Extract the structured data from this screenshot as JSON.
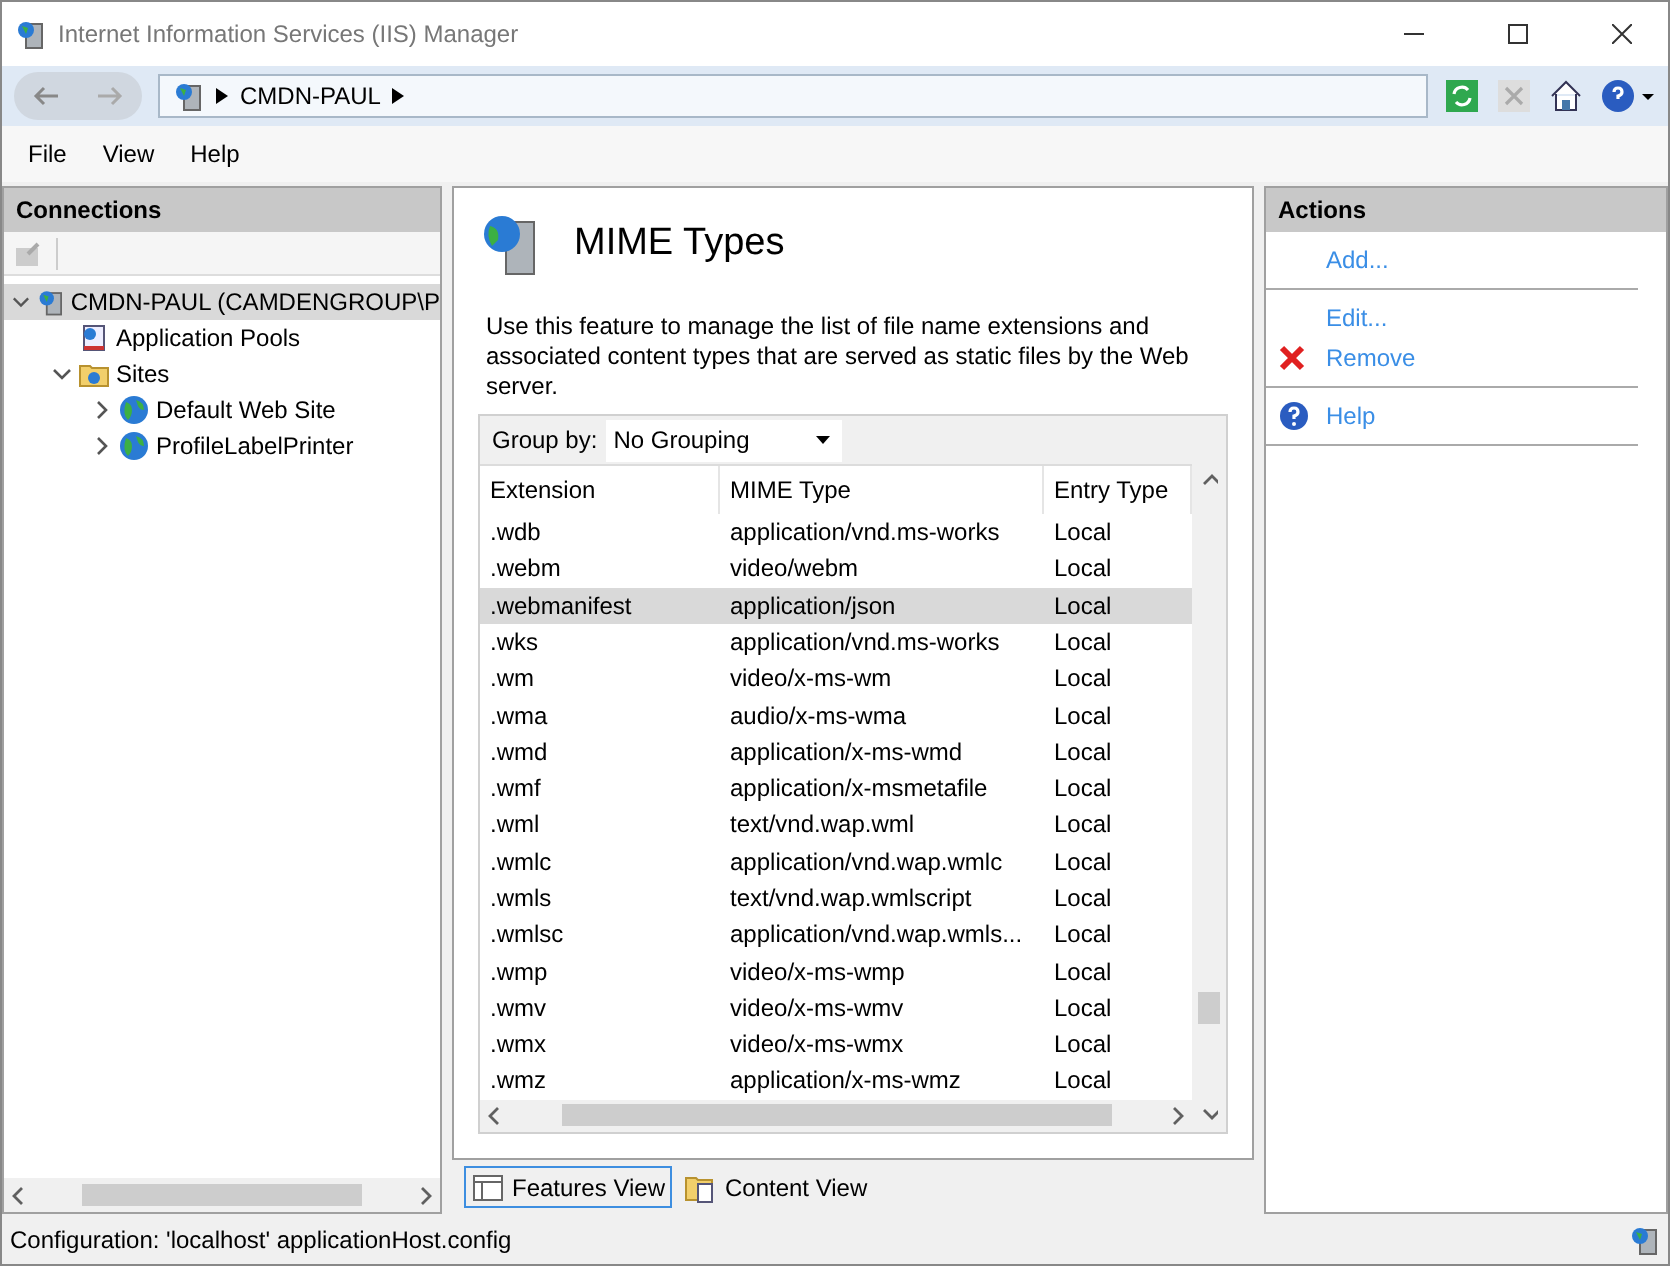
{
  "window": {
    "title": "Internet Information Services (IIS) Manager"
  },
  "address": {
    "crumbs": [
      "CMDN-PAUL"
    ]
  },
  "menu": [
    "File",
    "View",
    "Help"
  ],
  "connections": {
    "title": "Connections",
    "tree": [
      {
        "label": "CMDN-PAUL (CAMDENGROUP\\P",
        "kind": "server",
        "expanded": true,
        "selected": true,
        "children": [
          {
            "label": "Application Pools",
            "kind": "pools",
            "selected": false
          },
          {
            "label": "Sites",
            "kind": "sites",
            "expanded": true,
            "selected": false,
            "children": [
              {
                "label": "Default Web Site",
                "kind": "site",
                "expanded": false,
                "selected": false
              },
              {
                "label": "ProfileLabelPrinter",
                "kind": "site",
                "expanded": false,
                "selected": false
              }
            ]
          }
        ]
      }
    ]
  },
  "feature": {
    "title": "MIME Types",
    "description": "Use this feature to manage the list of file name extensions and associated content types that are served as static files by the Web server.",
    "group_by": {
      "label": "Group by:",
      "value": "No Grouping"
    },
    "columns": [
      "Extension",
      "MIME Type",
      "Entry Type"
    ],
    "rows": [
      {
        "cells": [
          ".wdb",
          "application/vnd.ms-works",
          "Local"
        ],
        "selected": false
      },
      {
        "cells": [
          ".webm",
          "video/webm",
          "Local"
        ],
        "selected": false
      },
      {
        "cells": [
          ".webmanifest",
          "application/json",
          "Local"
        ],
        "selected": true
      },
      {
        "cells": [
          ".wks",
          "application/vnd.ms-works",
          "Local"
        ],
        "selected": false
      },
      {
        "cells": [
          ".wm",
          "video/x-ms-wm",
          "Local"
        ],
        "selected": false
      },
      {
        "cells": [
          ".wma",
          "audio/x-ms-wma",
          "Local"
        ],
        "selected": false
      },
      {
        "cells": [
          ".wmd",
          "application/x-ms-wmd",
          "Local"
        ],
        "selected": false
      },
      {
        "cells": [
          ".wmf",
          "application/x-msmetafile",
          "Local"
        ],
        "selected": false
      },
      {
        "cells": [
          ".wml",
          "text/vnd.wap.wml",
          "Local"
        ],
        "selected": false
      },
      {
        "cells": [
          ".wmlc",
          "application/vnd.wap.wmlc",
          "Local"
        ],
        "selected": false
      },
      {
        "cells": [
          ".wmls",
          "text/vnd.wap.wmlscript",
          "Local"
        ],
        "selected": false
      },
      {
        "cells": [
          ".wmlsc",
          "application/vnd.wap.wmls...",
          "Local"
        ],
        "selected": false
      },
      {
        "cells": [
          ".wmp",
          "video/x-ms-wmp",
          "Local"
        ],
        "selected": false
      },
      {
        "cells": [
          ".wmv",
          "video/x-ms-wmv",
          "Local"
        ],
        "selected": false
      },
      {
        "cells": [
          ".wmx",
          "video/x-ms-wmx",
          "Local"
        ],
        "selected": false
      },
      {
        "cells": [
          ".wmz",
          "application/x-ms-wmz",
          "Local"
        ],
        "selected": false
      }
    ],
    "views": [
      {
        "label": "Features View",
        "kind": "features",
        "selected": true
      },
      {
        "label": "Content View",
        "kind": "content",
        "selected": false
      }
    ]
  },
  "actions": {
    "title": "Actions",
    "groups": [
      [
        {
          "label": "Add...",
          "kind": "none"
        }
      ],
      [
        {
          "label": "Edit...",
          "kind": "none"
        },
        {
          "label": "Remove",
          "kind": "remove"
        }
      ],
      [
        {
          "label": "Help",
          "kind": "help"
        }
      ]
    ]
  },
  "status_bar": "Configuration: 'localhost' applicationHost.config"
}
